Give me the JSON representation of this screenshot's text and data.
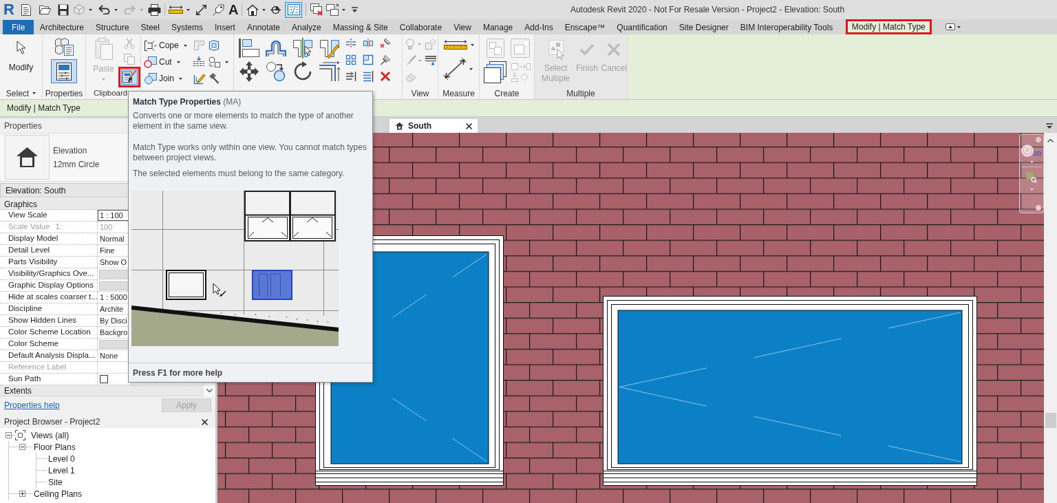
{
  "title_bar": {
    "logo": "R",
    "quick_access": {
      "text_tool": "A",
      "thin_lines_on": true
    },
    "title": "Autodesk Revit 2020 - Not For Resale Version - Project2 - Elevation: South"
  },
  "tabs": [
    {
      "label": "File",
      "kind": "file",
      "selected": false,
      "marked": false
    },
    {
      "label": "Architecture",
      "kind": "tab",
      "selected": false,
      "marked": false
    },
    {
      "label": "Structure",
      "kind": "tab",
      "selected": false,
      "marked": false
    },
    {
      "label": "Steel",
      "kind": "tab",
      "selected": false,
      "marked": false
    },
    {
      "label": "Systems",
      "kind": "tab",
      "selected": false,
      "marked": false
    },
    {
      "label": "Insert",
      "kind": "tab",
      "selected": false,
      "marked": false
    },
    {
      "label": "Annotate",
      "kind": "tab",
      "selected": false,
      "marked": false
    },
    {
      "label": "Analyze",
      "kind": "tab",
      "selected": false,
      "marked": false
    },
    {
      "label": "Massing & Site",
      "kind": "tab",
      "selected": false,
      "marked": false
    },
    {
      "label": "Collaborate",
      "kind": "tab",
      "selected": false,
      "marked": false
    },
    {
      "label": "View",
      "kind": "tab",
      "selected": false,
      "marked": false
    },
    {
      "label": "Manage",
      "kind": "tab",
      "selected": false,
      "marked": false
    },
    {
      "label": "Add-Ins",
      "kind": "tab",
      "selected": false,
      "marked": false
    },
    {
      "label": "Enscape™",
      "kind": "tab",
      "selected": false,
      "marked": false
    },
    {
      "label": "Quantification",
      "kind": "tab",
      "selected": false,
      "marked": false
    },
    {
      "label": "Site Designer",
      "kind": "tab",
      "selected": false,
      "marked": false
    },
    {
      "label": "BIM Interoperability Tools",
      "kind": "tab",
      "selected": false,
      "marked": false
    },
    {
      "label": "Modify | Match Type",
      "kind": "contextual",
      "selected": true,
      "marked": true
    }
  ],
  "ribbon": {
    "panels": [
      {
        "kind": "select",
        "label": "Select",
        "buttons": [
          {
            "label": "Modify",
            "disabled": false
          }
        ]
      },
      {
        "kind": "properties",
        "label": "Properties",
        "on": true
      },
      {
        "kind": "clipboard",
        "label": "Clipboard",
        "buttons": [
          {
            "label": "Paste",
            "disabled": true
          }
        ],
        "tools": [
          {
            "kind": "cut",
            "disabled": true,
            "active": false,
            "marked": false
          },
          {
            "kind": "copy",
            "disabled": true,
            "active": false,
            "marked": false
          },
          {
            "kind": "match_type",
            "disabled": false,
            "active": true,
            "marked": true
          }
        ]
      },
      {
        "kind": "geometry",
        "buttons": [
          {
            "label": "Cope",
            "disabled": false
          },
          {
            "label": "Cut",
            "disabled": false
          },
          {
            "label": "Join",
            "disabled": false
          }
        ]
      },
      {
        "kind": "modify"
      },
      {
        "kind": "view",
        "label": "View"
      },
      {
        "kind": "measure",
        "label": "Measure"
      },
      {
        "kind": "create",
        "label": "Create"
      },
      {
        "kind": "multiple",
        "label": "Multiple",
        "buttons": [
          {
            "label": "Select Multiple",
            "disabled": true
          },
          {
            "label": "Finish",
            "disabled": true
          },
          {
            "label": "Cancel",
            "disabled": true
          }
        ]
      }
    ]
  },
  "options_bar": {
    "label": "Modify | Match Type"
  },
  "properties": {
    "title": "Properties",
    "type": {
      "family": "Elevation",
      "name": "12mm Circle"
    },
    "instance": "Elevation: South",
    "sections": [
      {
        "label": "Graphics",
        "rows": [
          {
            "name": "View Scale",
            "kind": "field",
            "value": "1 : 100",
            "disabled": false
          },
          {
            "name": "Scale Value",
            "suffix": "1:",
            "kind": "text",
            "value": "100",
            "disabled": true
          },
          {
            "name": "Display Model",
            "kind": "text",
            "value": "Normal",
            "disabled": false
          },
          {
            "name": "Detail Level",
            "kind": "text",
            "value": "Fine",
            "disabled": false
          },
          {
            "name": "Parts Visibility",
            "kind": "text",
            "value": "Show O",
            "disabled": false
          },
          {
            "name": "Visibility/Graphics Ove...",
            "kind": "button",
            "disabled": false
          },
          {
            "name": "Graphic Display Options",
            "kind": "button",
            "disabled": false
          },
          {
            "name": "Hide at scales coarser t...",
            "kind": "text",
            "value": "1 : 5000",
            "disabled": false
          },
          {
            "name": "Discipline",
            "kind": "text",
            "value": "Archite",
            "disabled": false
          },
          {
            "name": "Show Hidden Lines",
            "kind": "text",
            "value": "By Disci",
            "disabled": false
          },
          {
            "name": "Color Scheme Location",
            "kind": "text",
            "value": "Backgro",
            "disabled": false
          },
          {
            "name": "Color Scheme",
            "kind": "button",
            "disabled": false
          },
          {
            "name": "Default Analysis Displa...",
            "kind": "text",
            "value": "None",
            "disabled": false
          },
          {
            "name": "Reference Label",
            "kind": "empty",
            "disabled": true
          },
          {
            "name": "Sun Path",
            "kind": "checkbox",
            "checked": false,
            "disabled": false
          }
        ]
      },
      {
        "label": "Extents"
      }
    ],
    "help_link": "Properties help",
    "apply": {
      "label": "Apply",
      "disabled": true
    }
  },
  "project_browser": {
    "title": "Project Browser - Project2",
    "tree": [
      {
        "label": "Views (all)",
        "expanded": true,
        "children": [
          {
            "label": "Floor Plans",
            "expanded": true,
            "children": [
              {
                "label": "Level 0"
              },
              {
                "label": "Level 1"
              },
              {
                "label": "Site"
              }
            ]
          },
          {
            "label": "Ceiling Plans",
            "expanded": false
          }
        ]
      }
    ]
  },
  "view": {
    "tabs": [
      {
        "label": "South",
        "selected": true
      }
    ],
    "navigation_bar": {
      "wheel_label": "2D"
    }
  },
  "tooltip": {
    "title": "**Match Type Properties** (MA)",
    "paragraphs": [
      "Converts one or more elements to match the type of another element in the same view.",
      "Match Type works only within one view. You cannot match types between project views.",
      "The selected elements must belong to the same category."
    ],
    "footer": "Press F1 for more help"
  }
}
